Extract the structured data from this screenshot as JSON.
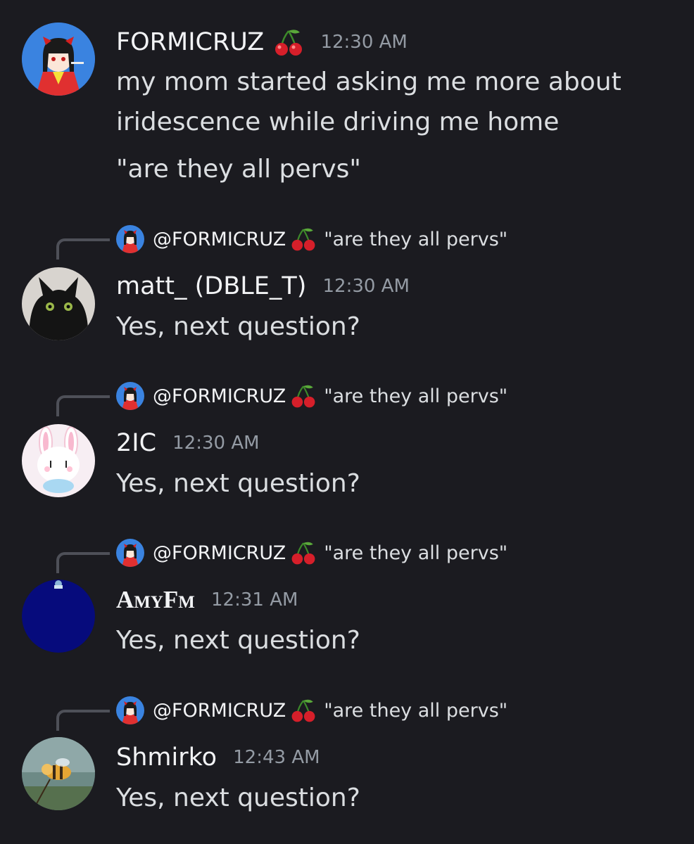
{
  "original_message": {
    "username": "FORMICRUZ",
    "emoji": "cherry-emoji",
    "timestamp": "12:30 AM",
    "lines": [
      "my mom started asking me more about",
      "iridescence while driving me home",
      "\"are they all pervs\""
    ]
  },
  "replies": [
    {
      "reply_to": {
        "mention": "@FORMICRUZ",
        "quote": "\"are they all pervs\""
      },
      "username": "matt_ (DBLE_T)",
      "timestamp": "12:30 AM",
      "text": "Yes, next question?"
    },
    {
      "reply_to": {
        "mention": "@FORMICRUZ",
        "quote": "\"are they all pervs\""
      },
      "username": "2IC",
      "timestamp": "12:30 AM",
      "text": "Yes, next question?"
    },
    {
      "reply_to": {
        "mention": "@FORMICRUZ",
        "quote": "\"are they all pervs\""
      },
      "username": "AmyFm",
      "timestamp": "12:31 AM",
      "text": "Yes, next question?"
    },
    {
      "reply_to": {
        "mention": "@FORMICRUZ",
        "quote": "\"are they all pervs\""
      },
      "username": "Shmirko",
      "timestamp": "12:43 AM",
      "text": "Yes, next question?"
    }
  ],
  "colors": {
    "background": "#1b1b20",
    "username": "#f2f3f5",
    "text": "#dbdee1",
    "timestamp": "#949ba4",
    "reply_spine": "#4e5058"
  }
}
